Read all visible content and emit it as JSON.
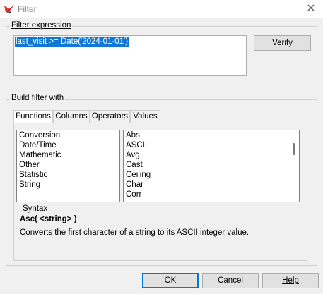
{
  "window": {
    "title": "Filter",
    "icon": "app-logo-icon",
    "close_glyph": "✕"
  },
  "filter_expression": {
    "label": "Filter expression",
    "value": "last_visit >= Date('2024-01-01')",
    "verify_label": "Verify"
  },
  "build": {
    "label": "Build filter with",
    "tabs": [
      "Functions",
      "Columns",
      "Operators",
      "Values"
    ],
    "active_tab": "Functions",
    "categories": [
      "Conversion",
      "Date/Time",
      "Mathematic",
      "Other",
      "Statistic",
      "String"
    ],
    "functions": [
      "Abs",
      "ASCII",
      "Avg",
      "Cast",
      "Ceiling",
      "Char",
      "Corr"
    ]
  },
  "syntax": {
    "label": "Syntax",
    "signature": "Asc( <string> )",
    "description": "Converts the first character of a string to its ASCII integer value."
  },
  "buttons": {
    "ok": "OK",
    "cancel": "Cancel",
    "help": "Help"
  },
  "colors": {
    "selection": "#0f78d7",
    "default_button_border": "#0078d7",
    "background": "#f0f0f0"
  }
}
